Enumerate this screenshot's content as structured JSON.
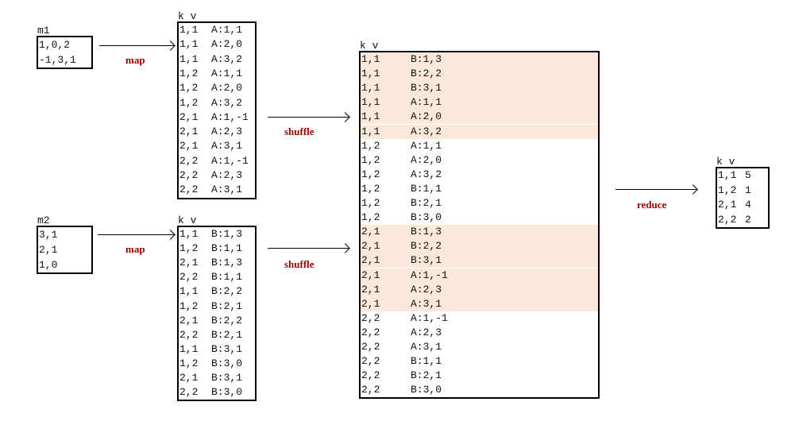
{
  "m1": {
    "caption": "m1",
    "rows": [
      "1,0,2",
      "-1,3,1"
    ]
  },
  "m2": {
    "caption": "m2",
    "rows": [
      "3,1",
      "2,1",
      "1,0"
    ]
  },
  "map1": {
    "caption": "k v",
    "rows": [
      [
        "1,1",
        "A:1,1"
      ],
      [
        "1,1",
        "A:2,0"
      ],
      [
        "1,1",
        "A:3,2"
      ],
      [
        "1,2",
        "A:1,1"
      ],
      [
        "1,2",
        "A:2,0"
      ],
      [
        "1,2",
        "A:3,2"
      ],
      [
        "2,1",
        "A:1,-1"
      ],
      [
        "2,1",
        "A:2,3"
      ],
      [
        "2,1",
        "A:3,1"
      ],
      [
        "2,2",
        "A:1,-1"
      ],
      [
        "2,2",
        "A:2,3"
      ],
      [
        "2,2",
        "A:3,1"
      ]
    ]
  },
  "map2": {
    "caption": "k v",
    "rows": [
      [
        "1,1",
        "B:1,3"
      ],
      [
        "1,2",
        "B:1,1"
      ],
      [
        "2,1",
        "B:1,3"
      ],
      [
        "2,2",
        "B:1,1"
      ],
      [
        "1,1",
        "B:2,2"
      ],
      [
        "1,2",
        "B:2,1"
      ],
      [
        "2,1",
        "B:2,2"
      ],
      [
        "2,2",
        "B:2,1"
      ],
      [
        "1,1",
        "B:3,1"
      ],
      [
        "1,2",
        "B:3,0"
      ],
      [
        "2,1",
        "B:3,1"
      ],
      [
        "2,2",
        "B:3,0"
      ]
    ]
  },
  "shuffled": {
    "caption": "k v",
    "highlight_color": "#fbe8da",
    "highlighted_keys": [
      "1,1",
      "2,1"
    ],
    "rows": [
      [
        "1,1",
        "B:1,3"
      ],
      [
        "1,1",
        "B:2,2"
      ],
      [
        "1,1",
        "B:3,1"
      ],
      [
        "1,1",
        "A:1,1"
      ],
      [
        "1,1",
        "A:2,0"
      ],
      [
        "1,1",
        "A:3,2"
      ],
      [
        "1,2",
        "A:1,1"
      ],
      [
        "1,2",
        "A:2,0"
      ],
      [
        "1,2",
        "A:3,2"
      ],
      [
        "1,2",
        "B:1,1"
      ],
      [
        "1,2",
        "B:2,1"
      ],
      [
        "1,2",
        "B:3,0"
      ],
      [
        "2,1",
        "B:1,3"
      ],
      [
        "2,1",
        "B:2,2"
      ],
      [
        "2,1",
        "B:3,1"
      ],
      [
        "2,1",
        "A:1,-1"
      ],
      [
        "2,1",
        "A:2,3"
      ],
      [
        "2,1",
        "A:3,1"
      ],
      [
        "2,2",
        "A:1,-1"
      ],
      [
        "2,2",
        "A:2,3"
      ],
      [
        "2,2",
        "A:3,1"
      ],
      [
        "2,2",
        "B:1,1"
      ],
      [
        "2,2",
        "B:2,1"
      ],
      [
        "2,2",
        "B:3,0"
      ]
    ]
  },
  "reduced": {
    "caption": "k v",
    "rows": [
      [
        "1,1",
        "5"
      ],
      [
        "1,2",
        "1"
      ],
      [
        "2,1",
        "4"
      ],
      [
        "2,2",
        "2"
      ]
    ]
  },
  "labels": {
    "map1": "map",
    "map2": "map",
    "shuffle1": "shuffle",
    "shuffle2": "shuffle",
    "reduce": "reduce"
  },
  "label_color": "#a00000"
}
